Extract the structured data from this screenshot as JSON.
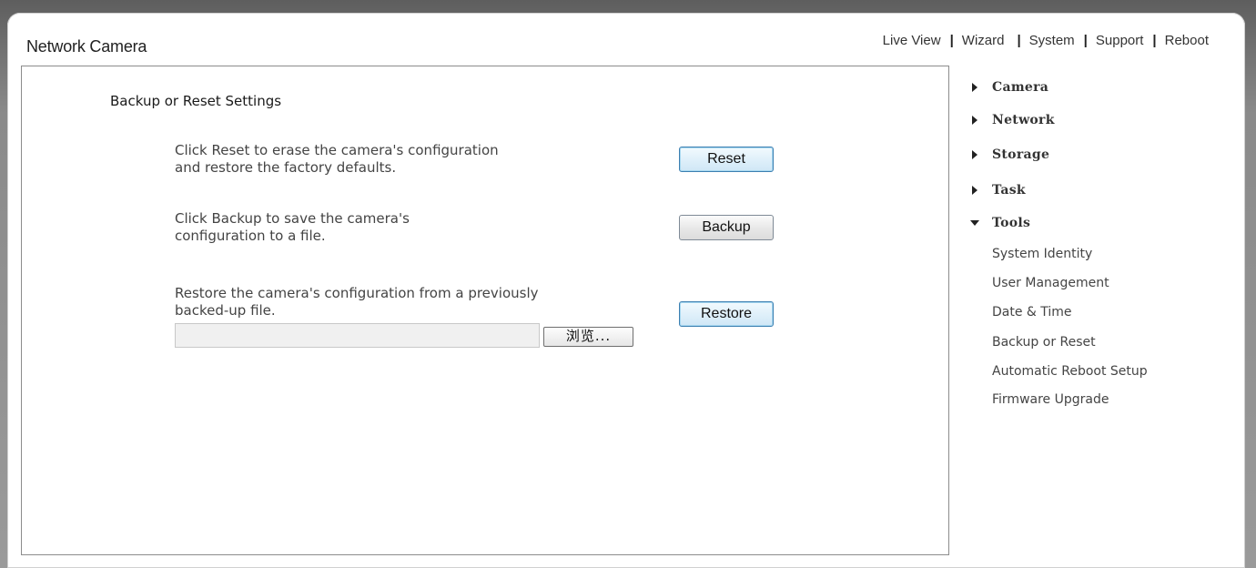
{
  "app": {
    "title": "Network Camera"
  },
  "topnav": {
    "items": [
      "Live View",
      "Wizard",
      "System",
      "Support",
      "Reboot"
    ],
    "separator": "|"
  },
  "main": {
    "title": "Backup or Reset Settings",
    "reset": {
      "description_line1": "Click Reset to erase the camera's configuration",
      "description_line2": "and restore the factory defaults.",
      "button_label": "Reset"
    },
    "backup": {
      "description_line1": "Click Backup to save the camera's",
      "description_line2": "configuration to a file.",
      "button_label": "Backup"
    },
    "restore": {
      "description_line1": "Restore the camera's configuration from a previously",
      "description_line2": "backed-up file.",
      "file_value": "",
      "browse_label": "浏览...",
      "button_label": "Restore"
    }
  },
  "sidebar": {
    "categories": [
      {
        "label": "Camera",
        "expanded": false
      },
      {
        "label": "Network",
        "expanded": false
      },
      {
        "label": "Storage",
        "expanded": false
      },
      {
        "label": "Task",
        "expanded": false
      },
      {
        "label": "Tools",
        "expanded": true
      }
    ],
    "tools_items": [
      "System Identity",
      "User Management",
      "Date & Time",
      "Backup or Reset",
      "Automatic Reboot Setup",
      "Firmware Upgrade"
    ]
  }
}
